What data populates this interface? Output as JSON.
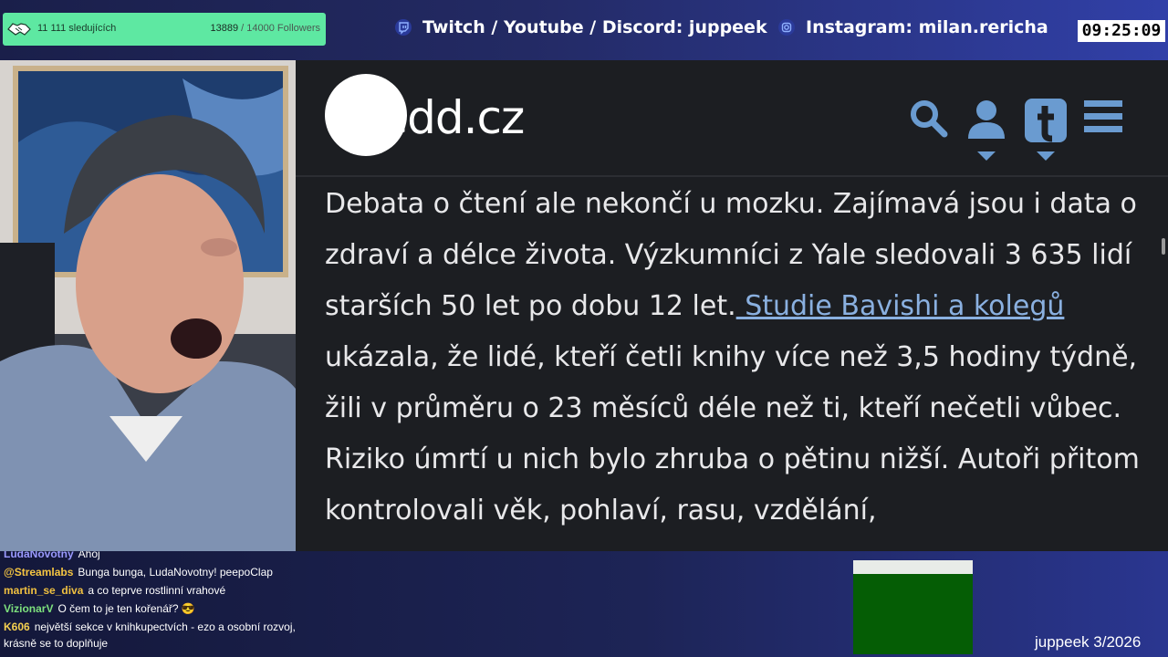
{
  "follower_goal": {
    "label": "11 111 sledujících",
    "current": "13889",
    "target": "/ 14000 Followers",
    "progress_fraction": 0.992
  },
  "socials": [
    {
      "icon": "twitch-icon",
      "text": "Twitch / Youtube / Discord: juppeek"
    },
    {
      "icon": "instagram-icon",
      "text": "Instagram: milan.rericha"
    }
  ],
  "clock": "09:25:09",
  "site": {
    "logo": "Nedd.cz",
    "header_icons": [
      "search-icon",
      "user-icon",
      "tumblr-icon",
      "menu-icon"
    ],
    "paragraph_before_link": "Debata o čtení ale nekončí u mozku. Zajímavá jsou i data o zdraví a délce života. Výzkumníci z Yale sledovali 3 635 lidí starších 50 let po dobu 12 let.",
    "link_text": " Studie Bavishi a kolegů",
    "paragraph_after_link": " ukázala, že lidé, kteří četli knihy více než 3,5 hodiny týdně, žili v průměru o 23 měsíců déle než ti, kteří nečetli vůbec. Riziko úmrtí u nich bylo zhruba o pětinu nižší. Autoři přitom kontrolovali věk, pohlaví, rasu, vzdělání,"
  },
  "chat": [
    {
      "user": "LudaNovotny",
      "color": "#9a9aff",
      "text": "Ahoj"
    },
    {
      "user": "@Streamlabs",
      "color": "#f5c542",
      "text": "Bunga bunga, LudaNovotny! peepoClap"
    },
    {
      "user": "martin_se_diva",
      "color": "#f0c040",
      "text": "a co teprve rostlinní vrahové"
    },
    {
      "user": "VizionarV",
      "color": "#7de07d",
      "text": "O čem to je ten kořenář? 😎"
    },
    {
      "user": "K606",
      "color": "#f5d050",
      "text": "největší sekce v knihkupectvích - ezo a osobní rozvoj, krásně se to doplňuje"
    }
  ],
  "signature": "juppeek 3/2026"
}
